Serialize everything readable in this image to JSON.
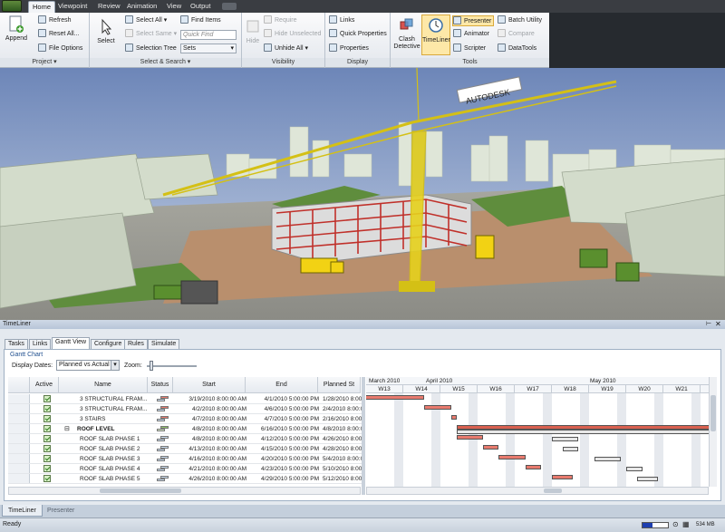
{
  "menu": {
    "tabs": [
      "Home",
      "Viewpoint",
      "Review",
      "Animation",
      "View",
      "Output"
    ],
    "active": "Home"
  },
  "ribbon": {
    "project": {
      "label": "Project",
      "append": "Append",
      "refresh": "Refresh",
      "reset_all": "Reset All...",
      "file_options": "File Options"
    },
    "select_search": {
      "label": "Select & Search",
      "select": "Select",
      "select_all": "Select All",
      "select_same": "Select Same",
      "selection_tree": "Selection Tree",
      "find_items": "Find Items",
      "quick_find_placeholder": "Quick Find",
      "sets": "Sets"
    },
    "visibility": {
      "label": "Visibility",
      "hide": "Hide",
      "require": "Require",
      "hide_unselected": "Hide Unselected",
      "unhide_all": "Unhide All"
    },
    "display": {
      "label": "Display",
      "links": "Links",
      "quick_properties": "Quick Properties",
      "properties": "Properties"
    },
    "tools": {
      "label": "Tools",
      "clash_detective": "Clash Detective",
      "timeliner": "TimeLiner",
      "presenter": "Presenter",
      "animator": "Animator",
      "scripter": "Scripter",
      "batch_utility": "Batch Utility",
      "compare": "Compare",
      "datatools": "DataTools"
    }
  },
  "viewport": {
    "crane_brand": "AUTODESK"
  },
  "panel": {
    "title": "TimeLiner",
    "tabs": [
      "Tasks",
      "Links",
      "Gantt View",
      "Configure",
      "Rules",
      "Simulate"
    ],
    "active_tab": "Gantt View",
    "section": "Gantt Chart",
    "display_dates_label": "Display Dates:",
    "display_dates_value": "Planned vs Actual",
    "zoom_label": "Zoom:",
    "zoom_level": 0.05,
    "columns": [
      "Active",
      "Name",
      "Status",
      "Start",
      "End",
      "Planned St"
    ],
    "rows": [
      {
        "name": "3 STRUCTURAL FRAM...",
        "start": "3/19/2010 8:00:00 AM",
        "end": "4/1/2010 5:00:00 PM",
        "planned": "1/28/2010 8:00:0",
        "indent": 1,
        "status": "late"
      },
      {
        "name": "3 STRUCTURAL FRAM...",
        "start": "4/2/2010 8:00:00 AM",
        "end": "4/6/2010 5:00:00 PM",
        "planned": "2/4/2010 8:00:0",
        "indent": 1,
        "status": "late"
      },
      {
        "name": "3 STAIRS",
        "start": "4/7/2010 8:00:00 AM",
        "end": "4/7/2010 5:00:00 PM",
        "planned": "2/16/2010 8:00:0",
        "indent": 1,
        "status": "late"
      },
      {
        "name": "ROOF LEVEL",
        "start": "4/8/2010 8:00:00 AM",
        "end": "6/16/2010 5:00:00 PM",
        "planned": "4/8/2010 8:00:0",
        "indent": 0,
        "status": "group",
        "expander": "⊟"
      },
      {
        "name": "ROOF SLAB PHASE 1",
        "start": "4/8/2010 8:00:00 AM",
        "end": "4/12/2010 5:00:00 PM",
        "planned": "4/26/2010 8:00:0",
        "indent": 1,
        "status": "early"
      },
      {
        "name": "ROOF SLAB PHASE 2",
        "start": "4/13/2010 8:00:00 AM",
        "end": "4/15/2010 5:00:00 PM",
        "planned": "4/28/2010 8:00:0",
        "indent": 1,
        "status": "early"
      },
      {
        "name": "ROOF SLAB PHASE 3",
        "start": "4/16/2010 8:00:00 AM",
        "end": "4/20/2010 5:00:00 PM",
        "planned": "5/4/2010 8:00:0",
        "indent": 1,
        "status": "early"
      },
      {
        "name": "ROOF SLAB PHASE 4",
        "start": "4/21/2010 8:00:00 AM",
        "end": "4/23/2010 5:00:00 PM",
        "planned": "5/10/2010 8:00:0",
        "indent": 1,
        "status": "early"
      },
      {
        "name": "ROOF SLAB PHASE 5",
        "start": "4/26/2010 8:00:00 AM",
        "end": "4/29/2010 5:00:00 PM",
        "planned": "5/12/2010 8:00:0",
        "indent": 1,
        "status": "early"
      }
    ],
    "months": [
      "March 2010",
      "April 2010",
      "May 2010"
    ],
    "weeks": [
      "W13",
      "W14",
      "W15",
      "W16",
      "W17",
      "W18",
      "W19",
      "W20",
      "W21"
    ]
  },
  "bottom_tabs": [
    "TimeLiner",
    "Presenter"
  ],
  "status": {
    "text": "Ready",
    "memory": "534 MB"
  },
  "colors": {
    "actual_bar": "#e87a6e",
    "planned_bar": "#e6e6e6",
    "summary_bar": "#d9604f",
    "sky_top": "#6d86b8",
    "sky_bottom": "#c7d3e6"
  }
}
